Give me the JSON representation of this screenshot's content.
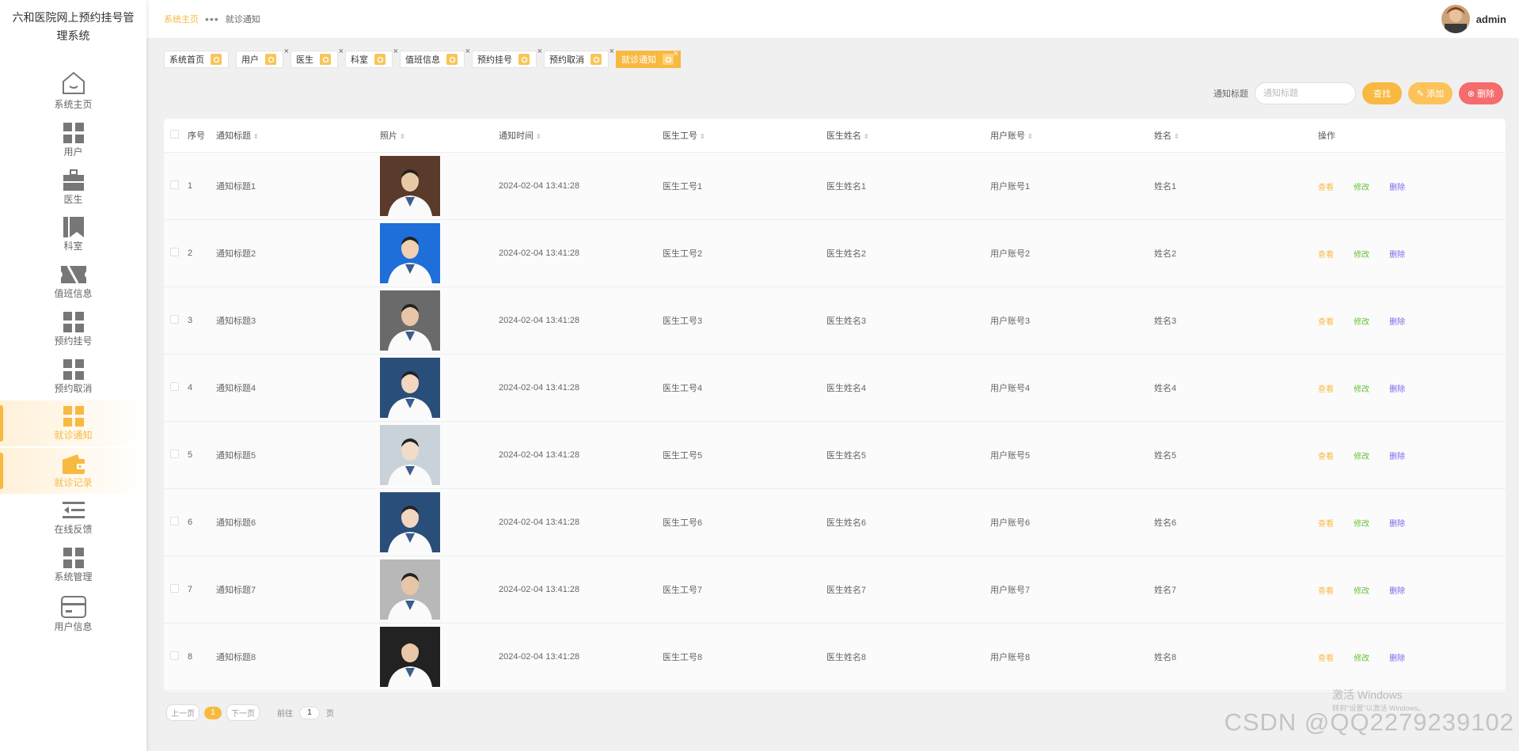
{
  "app": {
    "title": "六和医院网上预约挂号管理系统"
  },
  "sidebar": {
    "items": [
      {
        "label": "系统主页",
        "icon": "home-icon"
      },
      {
        "label": "用户",
        "icon": "grid-icon"
      },
      {
        "label": "医生",
        "icon": "briefcase-icon"
      },
      {
        "label": "科室",
        "icon": "bookmark-icon"
      },
      {
        "label": "值班信息",
        "icon": "ticket-icon"
      },
      {
        "label": "预约挂号",
        "icon": "grid-icon"
      },
      {
        "label": "预约取消",
        "icon": "grid-icon"
      },
      {
        "label": "就诊通知",
        "icon": "grid-icon"
      },
      {
        "label": "就诊记录",
        "icon": "wallet-icon"
      },
      {
        "label": "在线反馈",
        "icon": "list-icon"
      },
      {
        "label": "系统管理",
        "icon": "grid-icon"
      },
      {
        "label": "用户信息",
        "icon": "card-icon"
      }
    ]
  },
  "header": {
    "breadcrumb": {
      "home": "系统主页",
      "current": "就诊通知"
    },
    "username": "admin"
  },
  "tags": [
    {
      "label": "系统首页"
    },
    {
      "label": "用户"
    },
    {
      "label": "医生"
    },
    {
      "label": "科室"
    },
    {
      "label": "值班信息"
    },
    {
      "label": "预约挂号"
    },
    {
      "label": "预约取消"
    },
    {
      "label": "就诊通知"
    }
  ],
  "search": {
    "label": "通知标题",
    "placeholder": "通知标题",
    "search_btn": "查找",
    "add_btn": "添加",
    "delete_btn": "删除"
  },
  "table": {
    "headers": [
      "序号",
      "通知标题",
      "照片",
      "通知时间",
      "医生工号",
      "医生姓名",
      "用户账号",
      "姓名",
      "操作"
    ],
    "ops": {
      "view": "查看",
      "edit": "修改",
      "delete": "删除"
    },
    "rows": [
      {
        "idx": "1",
        "title": "通知标题1",
        "time": "2024-02-04 13:41:28",
        "doc_id": "医生工号1",
        "doc_name": "医生姓名1",
        "account": "用户账号1",
        "name": "姓名1"
      },
      {
        "idx": "2",
        "title": "通知标题2",
        "time": "2024-02-04 13:41:28",
        "doc_id": "医生工号2",
        "doc_name": "医生姓名2",
        "account": "用户账号2",
        "name": "姓名2"
      },
      {
        "idx": "3",
        "title": "通知标题3",
        "time": "2024-02-04 13:41:28",
        "doc_id": "医生工号3",
        "doc_name": "医生姓名3",
        "account": "用户账号3",
        "name": "姓名3"
      },
      {
        "idx": "4",
        "title": "通知标题4",
        "time": "2024-02-04 13:41:28",
        "doc_id": "医生工号4",
        "doc_name": "医生姓名4",
        "account": "用户账号4",
        "name": "姓名4"
      },
      {
        "idx": "5",
        "title": "通知标题5",
        "time": "2024-02-04 13:41:28",
        "doc_id": "医生工号5",
        "doc_name": "医生姓名5",
        "account": "用户账号5",
        "name": "姓名5"
      },
      {
        "idx": "6",
        "title": "通知标题6",
        "time": "2024-02-04 13:41:28",
        "doc_id": "医生工号6",
        "doc_name": "医生姓名6",
        "account": "用户账号6",
        "name": "姓名6"
      },
      {
        "idx": "7",
        "title": "通知标题7",
        "time": "2024-02-04 13:41:28",
        "doc_id": "医生工号7",
        "doc_name": "医生姓名7",
        "account": "用户账号7",
        "name": "姓名7"
      },
      {
        "idx": "8",
        "title": "通知标题8",
        "time": "2024-02-04 13:41:28",
        "doc_id": "医生工号8",
        "doc_name": "医生姓名8",
        "account": "用户账号8",
        "name": "姓名8"
      }
    ]
  },
  "pagination": {
    "prev": "上一页",
    "current": "1",
    "next": "下一页",
    "goto_label": "前往",
    "goto_value": "1",
    "page_unit": "页"
  },
  "watermark": {
    "title": "激活 Windows",
    "sub": "转到\"设置\"以激活 Windows。",
    "csdn": "CSDN @QQ2279239102"
  },
  "colors": {
    "accent": "#f8b941",
    "danger": "#f56c6c",
    "success": "#67c23a",
    "link": "#7b68ee"
  }
}
